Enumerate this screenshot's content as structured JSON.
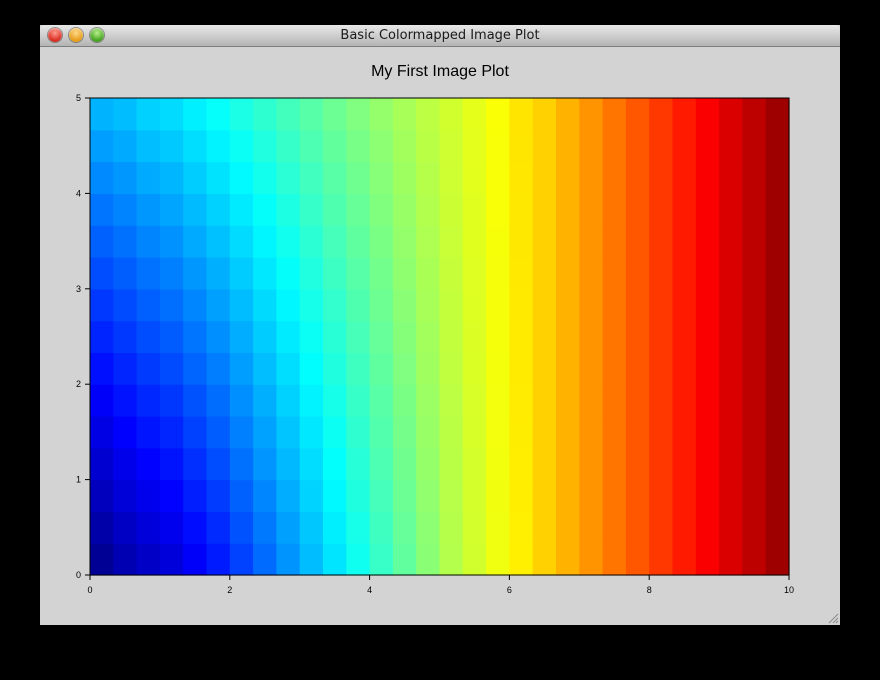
{
  "window": {
    "title": "Basic Colormapped Image Plot"
  },
  "icons": {
    "close": "close-button",
    "minimize": "minimize-button",
    "maximize": "zoom-button",
    "grip": "resize-grip-icon"
  },
  "chart_data": {
    "type": "heatmap",
    "title": "My First Image Plot",
    "xlabel": "",
    "ylabel": "",
    "xlim": [
      0,
      10
    ],
    "ylim": [
      0,
      5
    ],
    "xticks": [
      "0",
      "2",
      "4",
      "6",
      "8",
      "10"
    ],
    "yticks": [
      "0",
      "1",
      "2",
      "3",
      "4",
      "5"
    ],
    "grid": false,
    "colormap": "jet",
    "columns": 30,
    "rows": 15,
    "value_range": [
      0,
      1
    ],
    "column_values_bottom": [
      0.02,
      0.05,
      0.07,
      0.09,
      0.12,
      0.15,
      0.19,
      0.23,
      0.27,
      0.31,
      0.35,
      0.39,
      0.43,
      0.47,
      0.51,
      0.55,
      0.58,
      0.61,
      0.64,
      0.67,
      0.7,
      0.73,
      0.76,
      0.79,
      0.82,
      0.85,
      0.88,
      0.91,
      0.94,
      0.97
    ],
    "column_values_top": [
      0.3,
      0.31,
      0.33,
      0.34,
      0.36,
      0.38,
      0.4,
      0.42,
      0.44,
      0.46,
      0.48,
      0.5,
      0.52,
      0.54,
      0.56,
      0.58,
      0.6,
      0.62,
      0.65,
      0.67,
      0.7,
      0.73,
      0.76,
      0.79,
      0.82,
      0.85,
      0.88,
      0.91,
      0.94,
      0.97
    ]
  }
}
